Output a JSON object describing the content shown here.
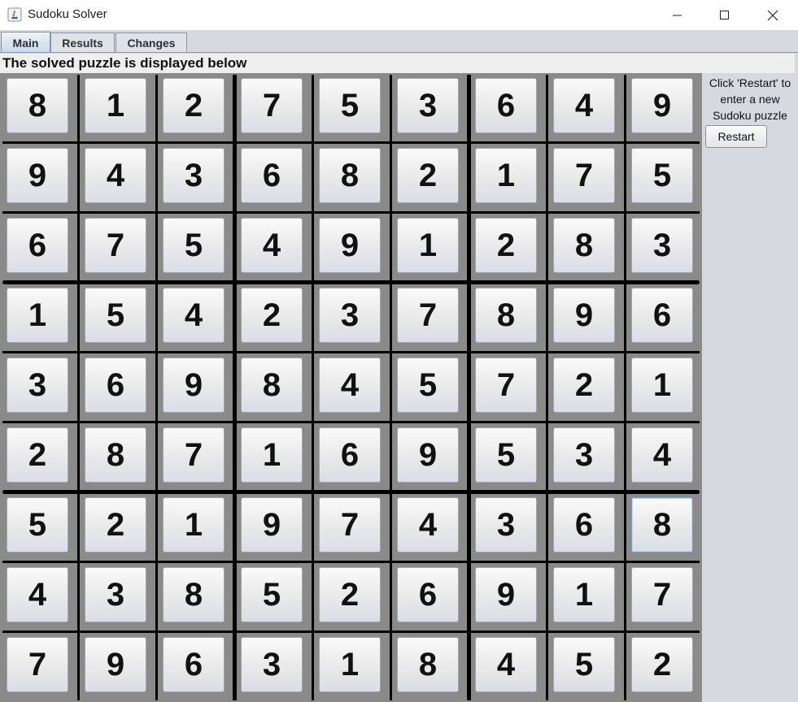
{
  "window": {
    "title": "Sudoku Solver",
    "controls": [
      "minimize",
      "maximize",
      "close"
    ]
  },
  "tabs": [
    {
      "label": "Main",
      "active": true
    },
    {
      "label": "Results",
      "active": false
    },
    {
      "label": "Changes",
      "active": false
    }
  ],
  "header": "The solved puzzle is displayed below",
  "grid": [
    [
      8,
      1,
      2,
      7,
      5,
      3,
      6,
      4,
      9
    ],
    [
      9,
      4,
      3,
      6,
      8,
      2,
      1,
      7,
      5
    ],
    [
      6,
      7,
      5,
      4,
      9,
      1,
      2,
      8,
      3
    ],
    [
      1,
      5,
      4,
      2,
      3,
      7,
      8,
      9,
      6
    ],
    [
      3,
      6,
      9,
      8,
      4,
      5,
      7,
      2,
      1
    ],
    [
      2,
      8,
      7,
      1,
      6,
      9,
      5,
      3,
      4
    ],
    [
      5,
      2,
      1,
      9,
      7,
      4,
      3,
      6,
      8
    ],
    [
      4,
      3,
      8,
      5,
      2,
      6,
      9,
      1,
      7
    ],
    [
      7,
      9,
      6,
      3,
      1,
      8,
      4,
      5,
      2
    ]
  ],
  "focused_cell": {
    "row": 7,
    "col": 9
  },
  "side_panel": {
    "message_lines": [
      "Click 'Restart' to",
      "enter a new",
      "Sudoku puzzle"
    ],
    "restart_label": "Restart"
  }
}
